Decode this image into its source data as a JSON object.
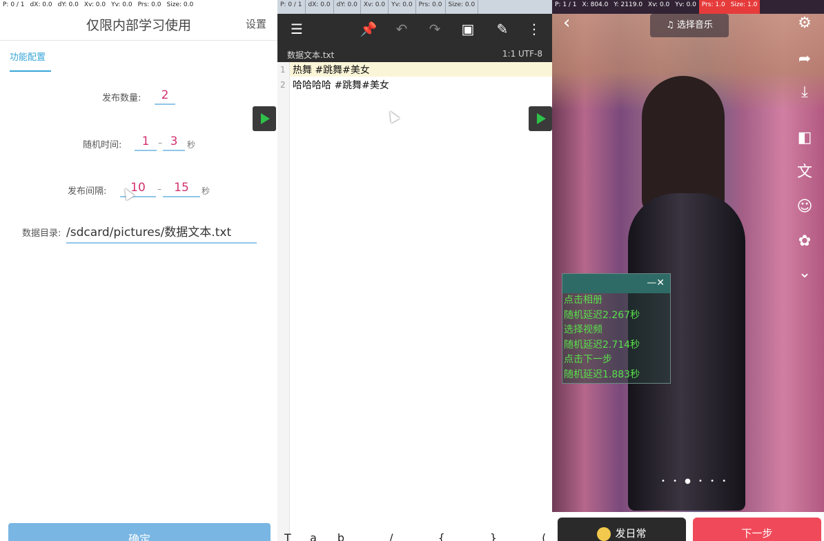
{
  "panel1": {
    "status": [
      "P: 0 / 1",
      "dX: 0.0",
      "dY: 0.0",
      "Xv: 0.0",
      "Yv: 0.0",
      "Prs: 0.0",
      "Size: 0.0"
    ],
    "title": "仅限内部学习使用",
    "settings": "设置",
    "tab": "功能配置",
    "publish_count": {
      "label": "发布数量:",
      "value": "2"
    },
    "random_time": {
      "label": "随机时间:",
      "min": "1",
      "dash": "–",
      "max": "3",
      "unit": "秒"
    },
    "publish_interval": {
      "label": "发布间隔:",
      "min": "10",
      "dash": "–",
      "max": "15",
      "unit": "秒"
    },
    "data_dir": {
      "label": "数据目录:",
      "value": "/sdcard/pictures/数据文本.txt"
    },
    "confirm": "确定"
  },
  "panel2": {
    "status": [
      "P: 0 / 1",
      "dX: 0.0",
      "dY: 0.0",
      "Xv: 0.0",
      "Yv: 0.0",
      "Prs: 0.0",
      "Size: 0.0"
    ],
    "filename": "数据文本.txt",
    "encoding": "1:1  UTF-8",
    "lines": [
      {
        "num": "1",
        "text": "热舞 #跳舞#美女"
      },
      {
        "num": "2",
        "text": "哈哈哈哈 #跳舞#美女"
      }
    ],
    "bottom_keys": "Tab  /  {  }  (  )  ;"
  },
  "panel3": {
    "status": [
      "P: 1 / 1",
      "X: 804.0",
      "Y: 2119.0",
      "Xv: 0.0",
      "Yv: 0.0",
      "Prs: 1.0",
      "Size: 1.0"
    ],
    "music": "♫ 选择音乐",
    "log": [
      "点击相册",
      "随机延迟2.267秒",
      "选择视频",
      "随机延迟2.714秒",
      "点击下一步",
      "随机延迟1.883秒"
    ],
    "daily": "发日常",
    "next": "下一步"
  }
}
